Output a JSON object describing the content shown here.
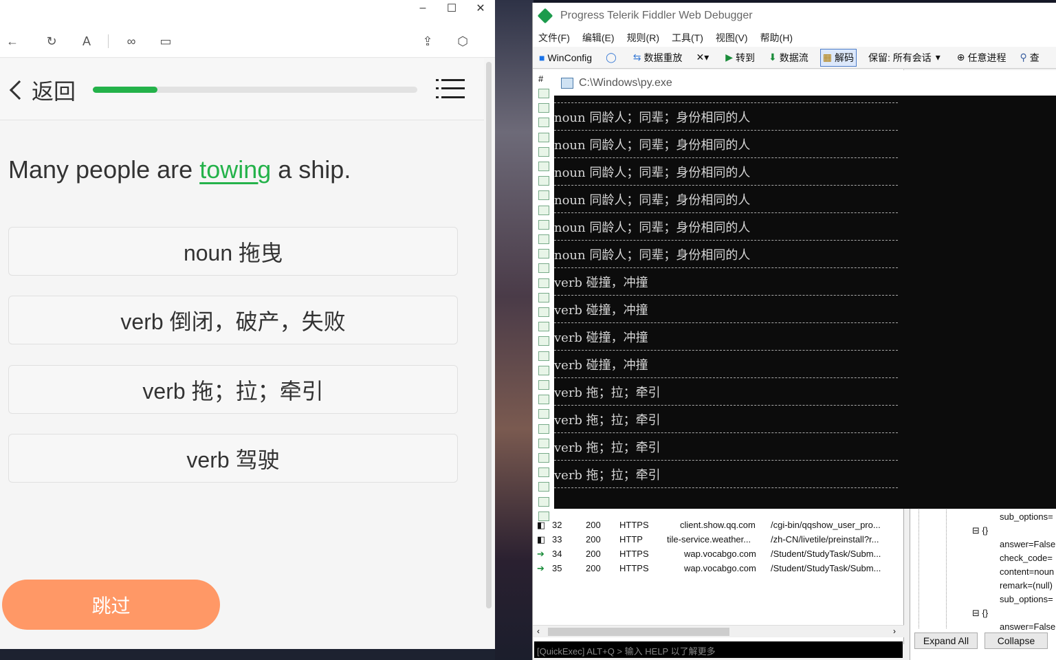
{
  "app": {
    "header": {
      "back_label": "返回",
      "progress": 0.2
    },
    "sentence": {
      "before": "Many people are ",
      "highlight": "towing",
      "after": " a ship."
    },
    "options": [
      "noun 拖曳",
      "verb 倒闭，破产，失败",
      "verb 拖；拉；牵引",
      "verb 驾驶"
    ],
    "skip_label": "跳过",
    "window_controls": {
      "minimize": "–",
      "maximize": "☐",
      "close": "✕"
    }
  },
  "fiddler": {
    "title": "Progress Telerik Fiddler Web Debugger",
    "menu": [
      "文件(F)",
      "编辑(E)",
      "规则(R)",
      "工具(T)",
      "视图(V)",
      "帮助(H)"
    ],
    "toolbar": {
      "winconfig": "WinConfig",
      "replay": "数据重放",
      "go": "转到",
      "stream": "数据流",
      "decode": "解码",
      "keep": "保留: 所有会话",
      "any_process": "任意进程",
      "find": "查"
    },
    "col_header": "#",
    "sessions": [
      {
        "id": "32",
        "result": "200",
        "protocol": "HTTPS",
        "host": "client.show.qq.com",
        "url": "/cgi-bin/qqshow_user_pro..."
      },
      {
        "id": "33",
        "result": "200",
        "protocol": "HTTP",
        "host": "tile-service.weather...",
        "url": "/zh-CN/livetile/preinstall?r..."
      },
      {
        "id": "34",
        "result": "200",
        "protocol": "HTTPS",
        "host": "wap.vocabgo.com",
        "url": "/Student/StudyTask/Subm..."
      },
      {
        "id": "35",
        "result": "200",
        "protocol": "HTTPS",
        "host": "wap.vocabgo.com",
        "url": "/Student/StudyTask/Subm..."
      }
    ],
    "quickexec": "[QuickExec] ALT+Q > 输入 HELP 以了解更多",
    "tree": {
      "lines": [
        "sub_options=",
        "{}",
        "answer=False",
        "check_code=",
        "content=noun",
        "remark=(null)",
        "sub_options=",
        "{}",
        "answer=False"
      ],
      "expand_all": "Expand All",
      "collapse": "Collapse"
    }
  },
  "console": {
    "title": "C:\\Windows\\py.exe",
    "lines": [
      "noun 同龄人；同辈；身份相同的人",
      "noun 同龄人；同辈；身份相同的人",
      "noun 同龄人；同辈；身份相同的人",
      "noun 同龄人；同辈；身份相同的人",
      "noun 同龄人；同辈；身份相同的人",
      "noun 同龄人；同辈；身份相同的人",
      "verb 碰撞，冲撞",
      "verb 碰撞，冲撞",
      "verb 碰撞，冲撞",
      "verb 碰撞，冲撞",
      "verb 拖；拉；牵引",
      "verb 拖；拉；牵引",
      "verb 拖；拉；牵引",
      "verb 拖；拉；牵引"
    ]
  }
}
